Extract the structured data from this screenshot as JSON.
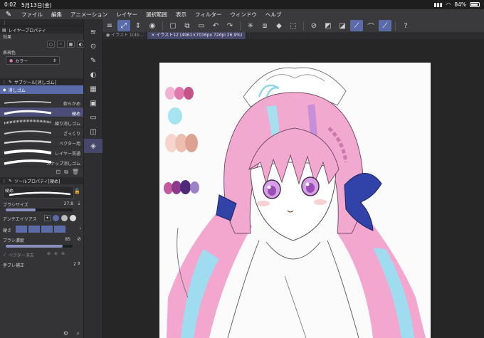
{
  "status_bar": {
    "time": "0:02",
    "date": "5月13日(金)",
    "battery": "84%"
  },
  "menu": [
    "ファイル",
    "編集",
    "アニメーション",
    "レイヤー",
    "選択範囲",
    "表示",
    "フィルター",
    "ウィンドウ",
    "ヘルプ"
  ],
  "tabs": [
    {
      "label": "● イラスト 1(4b...",
      "active": false
    },
    {
      "label": "✕ イラスト12 (4961×7016px 72dpi 26.9%)",
      "active": true
    }
  ],
  "layer_property": {
    "header": "レイヤープロパティ",
    "effect_label": "効果",
    "display_color_label": "表現色",
    "display_color_value": "カラー"
  },
  "sub_tool": {
    "header": "サブツール[消しゴム]",
    "group": "消しゴム",
    "brushes": [
      {
        "label": "軟らかめ",
        "selected": false
      },
      {
        "label": "硬め",
        "selected": true
      },
      {
        "label": "練り消しゴム",
        "selected": false
      },
      {
        "label": "ざっくり",
        "selected": false
      },
      {
        "label": "ベクター用",
        "selected": false
      },
      {
        "label": "レイヤー貫通",
        "selected": false
      },
      {
        "label": "スナップ消しゴム",
        "selected": false
      }
    ]
  },
  "tool_property": {
    "header": "ツールプロパティ[硬め]",
    "preset_name": "硬め",
    "brush_size_label": "ブラシサイズ",
    "brush_size_value": "27.8",
    "brush_size_fraction": 0.45,
    "antialias_label": "アンチエイリアス",
    "hardness_label": "硬さ",
    "density_label": "ブラシ濃度",
    "density_value": "85",
    "density_fraction": 0.85,
    "vector_erase_label": "ベクター消去",
    "stabilization_label": "手ブレ補正",
    "stabilization_value": "2"
  },
  "colors": {
    "accent": "#5a6ba8",
    "selected_row": "#4c4d77",
    "palette_row1": [
      "#f2b3d3",
      "#e07aae",
      "#c45488"
    ],
    "palette_cyan": "#a6e4f2",
    "palette_skin": [
      "#f6d6cc",
      "#edbfb1",
      "#dca293"
    ],
    "palette_purple": [
      "#c45aa0",
      "#8a3b8e",
      "#4e2a78",
      "#9c82c8"
    ]
  },
  "icons": {
    "toolbar": [
      "menu-icon",
      "move-layer-icon",
      "chevron-updown-icon",
      "select-icon",
      "new-layer-icon",
      "copy-icon",
      "fill-icon",
      "undo-icon",
      "redo-icon",
      "loading-icon",
      "transform-icon",
      "eraser-icon",
      "crop-icon",
      "clear-icon",
      "magic-wand-icon",
      "pen-icon",
      "ruler-icon",
      "correction-icon",
      "help-icon"
    ],
    "toolstrip": [
      "layers-icon",
      "zoom-icon",
      "pen-tool-icon",
      "blend-icon",
      "gradient-icon",
      "fill-tool-icon",
      "text-icon",
      "camera-icon",
      "eraser-tool-icon"
    ]
  }
}
